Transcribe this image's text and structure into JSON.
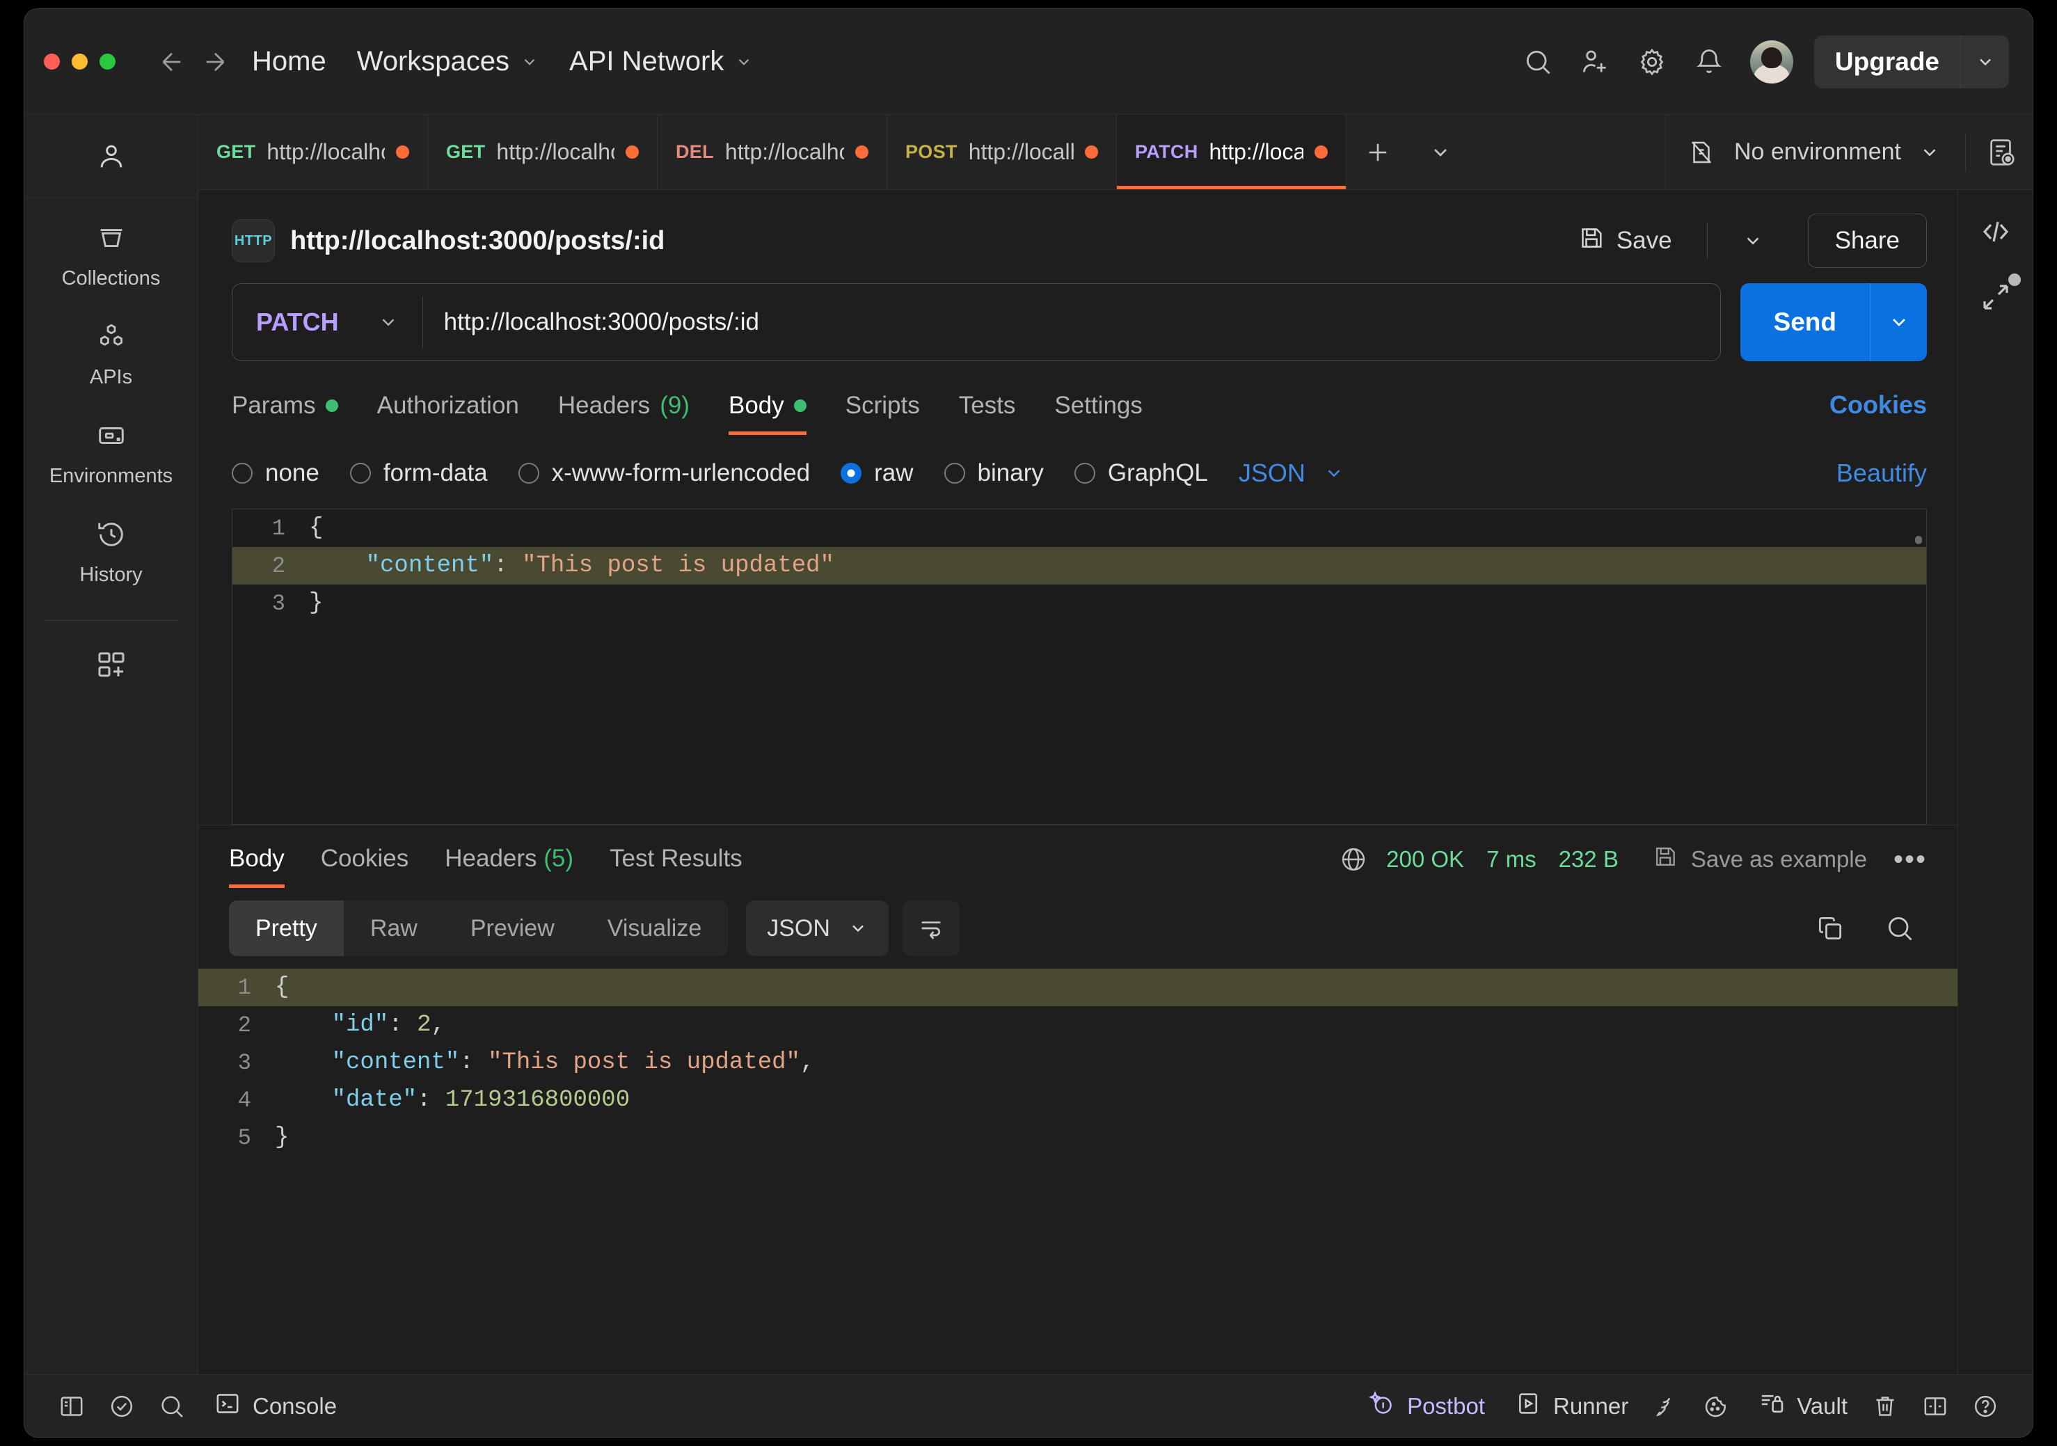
{
  "titlebar": {
    "nav": {
      "back": "back-arrow",
      "forward": "forward-arrow"
    },
    "menu": [
      {
        "label": "Home",
        "caret": false
      },
      {
        "label": "Workspaces",
        "caret": true
      },
      {
        "label": "API Network",
        "caret": true
      }
    ],
    "icons": [
      "search-icon",
      "invite-user-icon",
      "settings-gear-icon",
      "notifications-bell-icon"
    ],
    "upgrade_label": "Upgrade"
  },
  "sidebar": {
    "top_icon": "user-profile-icon",
    "items": [
      {
        "label": "Collections",
        "icon": "collections-icon"
      },
      {
        "label": "APIs",
        "icon": "apis-icon"
      },
      {
        "label": "Environments",
        "icon": "environments-icon"
      },
      {
        "label": "History",
        "icon": "history-clock-icon"
      }
    ],
    "add_label": "new-icon"
  },
  "tabs": [
    {
      "method": "GET",
      "url": "http://localhos",
      "dirty": true,
      "active": false
    },
    {
      "method": "GET",
      "url": "http://localhos",
      "dirty": true,
      "active": false
    },
    {
      "method": "DEL",
      "url": "http://localhos",
      "dirty": true,
      "active": false
    },
    {
      "method": "POST",
      "url": "http://localh",
      "dirty": true,
      "active": false
    },
    {
      "method": "PATCH",
      "url": "http://localh",
      "dirty": true,
      "active": true
    }
  ],
  "environment": {
    "label": "No environment",
    "icon": "no-environment-icon",
    "eye_icon": "environment-quick-look-icon"
  },
  "request": {
    "badge": "HTTP",
    "title": "http://localhost:3000/posts/:id",
    "save_label": "Save",
    "share_label": "Share",
    "method": "PATCH",
    "url": "http://localhost:3000/posts/:id",
    "send_label": "Send",
    "tabs": [
      {
        "label": "Params",
        "dot": true,
        "count": null,
        "active": false
      },
      {
        "label": "Authorization",
        "dot": false,
        "count": null,
        "active": false
      },
      {
        "label": "Headers",
        "dot": false,
        "count": "(9)",
        "active": false
      },
      {
        "label": "Body",
        "dot": true,
        "count": null,
        "active": true
      },
      {
        "label": "Scripts",
        "dot": false,
        "count": null,
        "active": false
      },
      {
        "label": "Tests",
        "dot": false,
        "count": null,
        "active": false
      },
      {
        "label": "Settings",
        "dot": false,
        "count": null,
        "active": false
      }
    ],
    "cookies_label": "Cookies",
    "body_types": [
      {
        "label": "none",
        "selected": false
      },
      {
        "label": "form-data",
        "selected": false
      },
      {
        "label": "x-www-form-urlencoded",
        "selected": false
      },
      {
        "label": "raw",
        "selected": true
      },
      {
        "label": "binary",
        "selected": false
      },
      {
        "label": "GraphQL",
        "selected": false
      }
    ],
    "format_label": "JSON",
    "beautify_label": "Beautify",
    "body_lines": [
      {
        "no": "1",
        "highlight": false,
        "tokens": [
          {
            "t": "p",
            "v": "{"
          }
        ]
      },
      {
        "no": "2",
        "highlight": true,
        "tokens": [
          {
            "t": "p",
            "v": "    "
          },
          {
            "t": "k",
            "v": "\"content\""
          },
          {
            "t": "p",
            "v": ": "
          },
          {
            "t": "s",
            "v": "\"This post is updated\""
          }
        ]
      },
      {
        "no": "3",
        "highlight": false,
        "tokens": [
          {
            "t": "p",
            "v": "}"
          }
        ]
      }
    ]
  },
  "response": {
    "tabs": [
      {
        "label": "Body",
        "count": null,
        "active": true
      },
      {
        "label": "Cookies",
        "count": null,
        "active": false
      },
      {
        "label": "Headers",
        "count": "(5)",
        "active": false
      },
      {
        "label": "Test Results",
        "count": null,
        "active": false
      }
    ],
    "status": "200 OK",
    "time": "7 ms",
    "size": "232 B",
    "save_example_label": "Save as example",
    "more_label": "•••",
    "views": [
      {
        "label": "Pretty",
        "active": true
      },
      {
        "label": "Raw",
        "active": false
      },
      {
        "label": "Preview",
        "active": false
      },
      {
        "label": "Visualize",
        "active": false
      }
    ],
    "format_label": "JSON",
    "body_lines": [
      {
        "no": "1",
        "highlight": true,
        "tokens": [
          {
            "t": "p",
            "v": "{"
          }
        ]
      },
      {
        "no": "2",
        "highlight": false,
        "tokens": [
          {
            "t": "p",
            "v": "    "
          },
          {
            "t": "k",
            "v": "\"id\""
          },
          {
            "t": "p",
            "v": ": "
          },
          {
            "t": "n",
            "v": "2"
          },
          {
            "t": "p",
            "v": ","
          }
        ]
      },
      {
        "no": "3",
        "highlight": false,
        "tokens": [
          {
            "t": "p",
            "v": "    "
          },
          {
            "t": "k",
            "v": "\"content\""
          },
          {
            "t": "p",
            "v": ": "
          },
          {
            "t": "s",
            "v": "\"This post is updated\""
          },
          {
            "t": "p",
            "v": ","
          }
        ]
      },
      {
        "no": "4",
        "highlight": false,
        "tokens": [
          {
            "t": "p",
            "v": "    "
          },
          {
            "t": "k",
            "v": "\"date\""
          },
          {
            "t": "p",
            "v": ": "
          },
          {
            "t": "n",
            "v": "1719316800000"
          }
        ]
      },
      {
        "no": "5",
        "highlight": false,
        "tokens": [
          {
            "t": "p",
            "v": "}"
          }
        ]
      }
    ]
  },
  "statusbar": {
    "left_icons": [
      "sidebar-toggle-icon",
      "check-circle-icon",
      "search-icon"
    ],
    "console_label": "Console",
    "right": [
      {
        "label": "Postbot",
        "icon": "postbot-icon",
        "accent": true
      },
      {
        "label": "Runner",
        "icon": "runner-icon",
        "accent": false
      },
      {
        "label": "",
        "icon": "network-icon",
        "accent": false
      },
      {
        "label": "",
        "icon": "cookies-icon",
        "accent": false
      },
      {
        "label": "Vault",
        "icon": "vault-icon",
        "accent": false
      },
      {
        "label": "",
        "icon": "trash-icon",
        "accent": false
      },
      {
        "label": "",
        "icon": "layout-icon",
        "accent": false
      },
      {
        "label": "",
        "icon": "help-icon",
        "accent": false
      }
    ]
  },
  "colors": {
    "accent_orange": "#ff6c37",
    "send_blue": "#0c71e0",
    "link_blue": "#3f8ae2",
    "status_green": "#6bdd9a",
    "method_patch": "#b89eff"
  }
}
